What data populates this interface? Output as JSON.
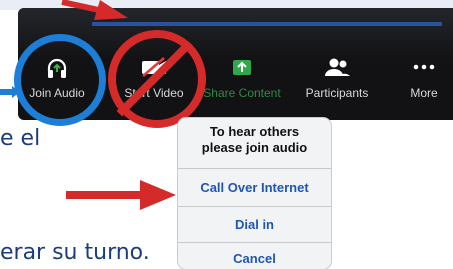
{
  "toolbar": {
    "buttons": [
      {
        "label": "Join Audio",
        "icon": "headphones-icon"
      },
      {
        "label": "Start Video",
        "icon": "video-camera-off-icon"
      },
      {
        "label": "Share Content",
        "icon": "share-screen-icon"
      },
      {
        "label": "Participants",
        "icon": "participants-icon"
      },
      {
        "label": "More",
        "icon": "more-dots-icon"
      }
    ]
  },
  "document": {
    "line1": "e el",
    "line2": "erar su turno."
  },
  "audio_popup": {
    "header_line1": "To hear others",
    "header_line2": "please join audio",
    "options": [
      "Call Over Internet",
      "Dial in",
      "Cancel"
    ]
  },
  "colors": {
    "annotation_red": "#d42a2a",
    "annotation_blue": "#1d7ed8",
    "option_blue": "#1f55b5",
    "share_green": "#2f8a43"
  }
}
